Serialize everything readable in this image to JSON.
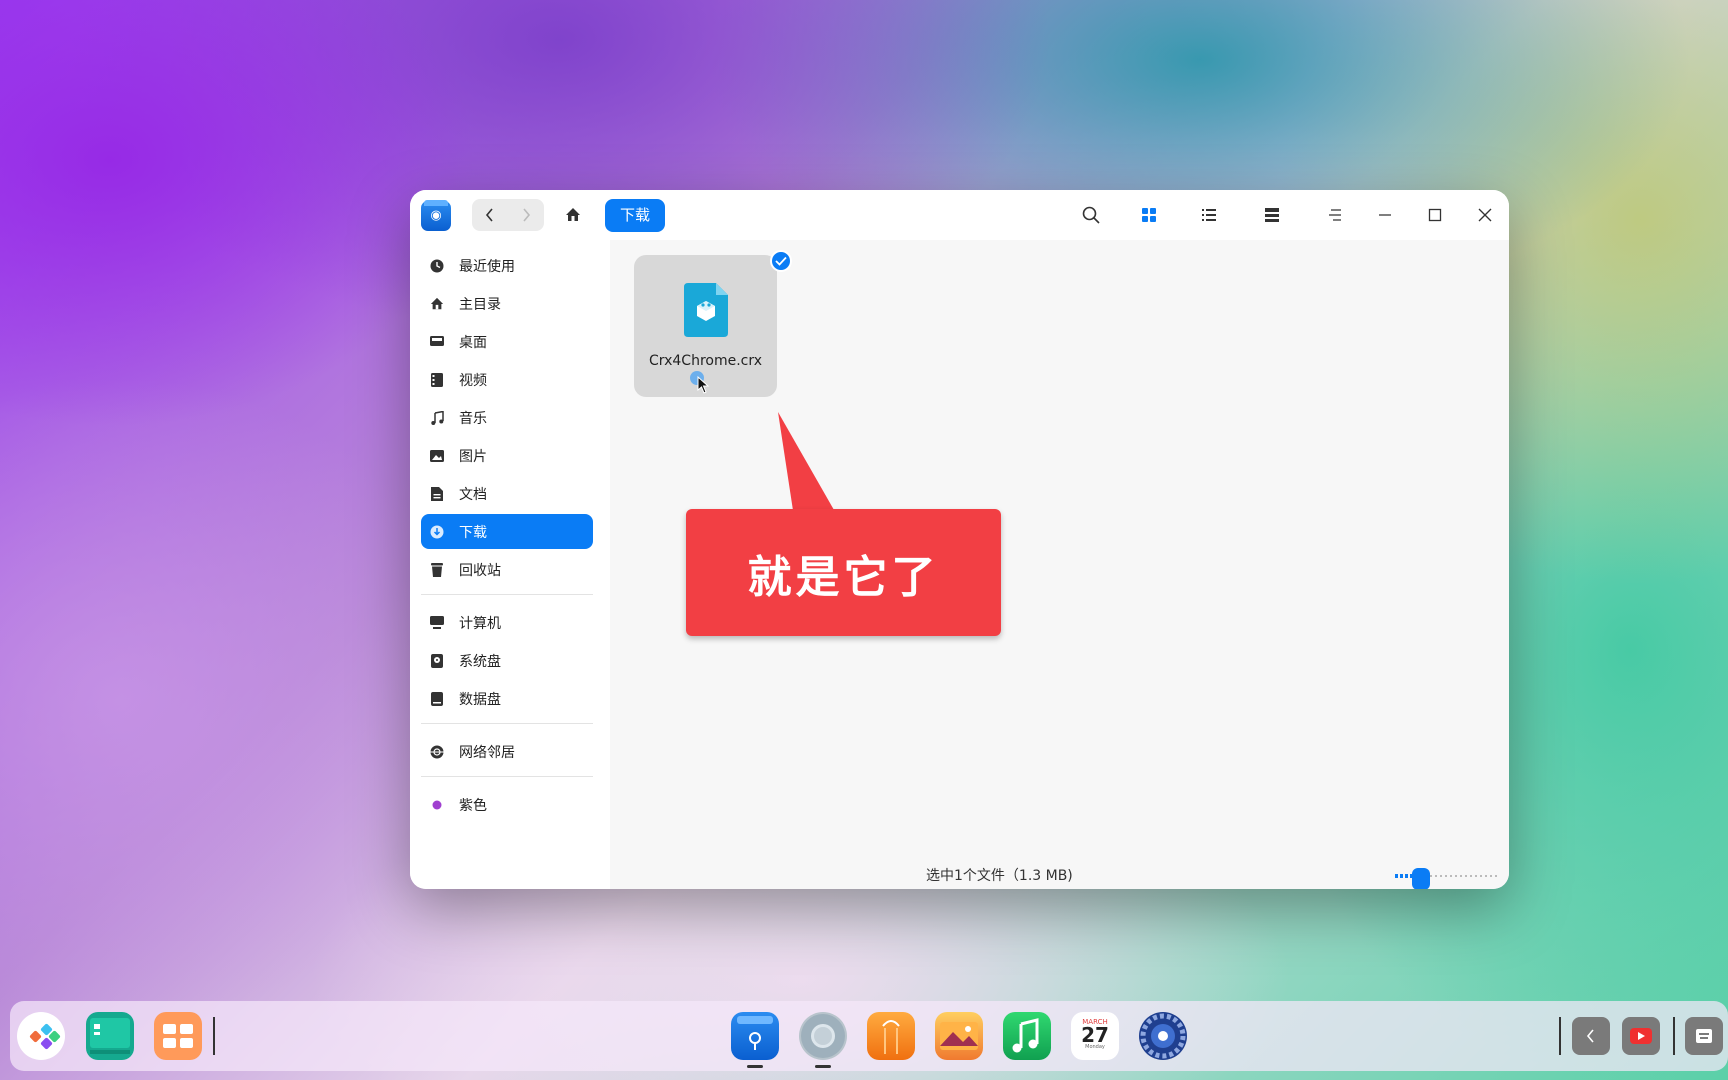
{
  "window": {
    "app_logo_icon": "file-manager-icon",
    "breadcrumb": "下载",
    "toolbar": {
      "back_icon": "chevron-left-icon",
      "forward_icon": "chevron-right-icon",
      "home_icon": "home-icon",
      "search_icon": "search-icon",
      "icon_view_icon": "grid-view-icon",
      "list_view_icon": "list-view-icon",
      "tree_view_icon": "tree-view-icon",
      "menu_icon": "menu-icon",
      "minimize_icon": "minimize-icon",
      "maximize_icon": "maximize-icon",
      "close_icon": "close-icon"
    }
  },
  "sidebar": {
    "items": [
      {
        "label": "最近使用",
        "icon": "clock-icon"
      },
      {
        "label": "主目录",
        "icon": "home-icon"
      },
      {
        "label": "桌面",
        "icon": "desktop-icon"
      },
      {
        "label": "视频",
        "icon": "video-icon"
      },
      {
        "label": "音乐",
        "icon": "music-icon"
      },
      {
        "label": "图片",
        "icon": "picture-icon"
      },
      {
        "label": "文档",
        "icon": "document-icon"
      },
      {
        "label": "下载",
        "icon": "download-icon",
        "active": true
      },
      {
        "label": "回收站",
        "icon": "trash-icon"
      },
      {
        "label": "计算机",
        "icon": "computer-icon"
      },
      {
        "label": "系统盘",
        "icon": "system-disk-icon"
      },
      {
        "label": "数据盘",
        "icon": "data-disk-icon"
      },
      {
        "label": "网络邻居",
        "icon": "network-icon"
      },
      {
        "label": "紫色",
        "icon": "purple-tag-icon",
        "color": "#a040d0"
      }
    ]
  },
  "content": {
    "files": [
      {
        "name": "Crx4Chrome.crx",
        "icon": "crx-file-icon",
        "selected": true
      }
    ],
    "callout": "就是它了",
    "status": "选中1个文件（1.3 MB)",
    "zoom_level": 0.25
  },
  "dock": {
    "apps": [
      "launcher-icon",
      "terminal-icon",
      "multitask-view-icon",
      "file-manager-icon",
      "browser-icon",
      "app-store-icon",
      "image-viewer-icon",
      "music-icon",
      "calendar-icon",
      "settings-icon"
    ],
    "calendar": {
      "month": "MARCH",
      "day": "27",
      "weekday": "Monday"
    },
    "tray": [
      "tray-collapse-icon",
      "screen-record-icon",
      "keyboard-icon"
    ]
  },
  "colors": {
    "accent": "#0a7cf5",
    "callout": "#f23f44"
  }
}
